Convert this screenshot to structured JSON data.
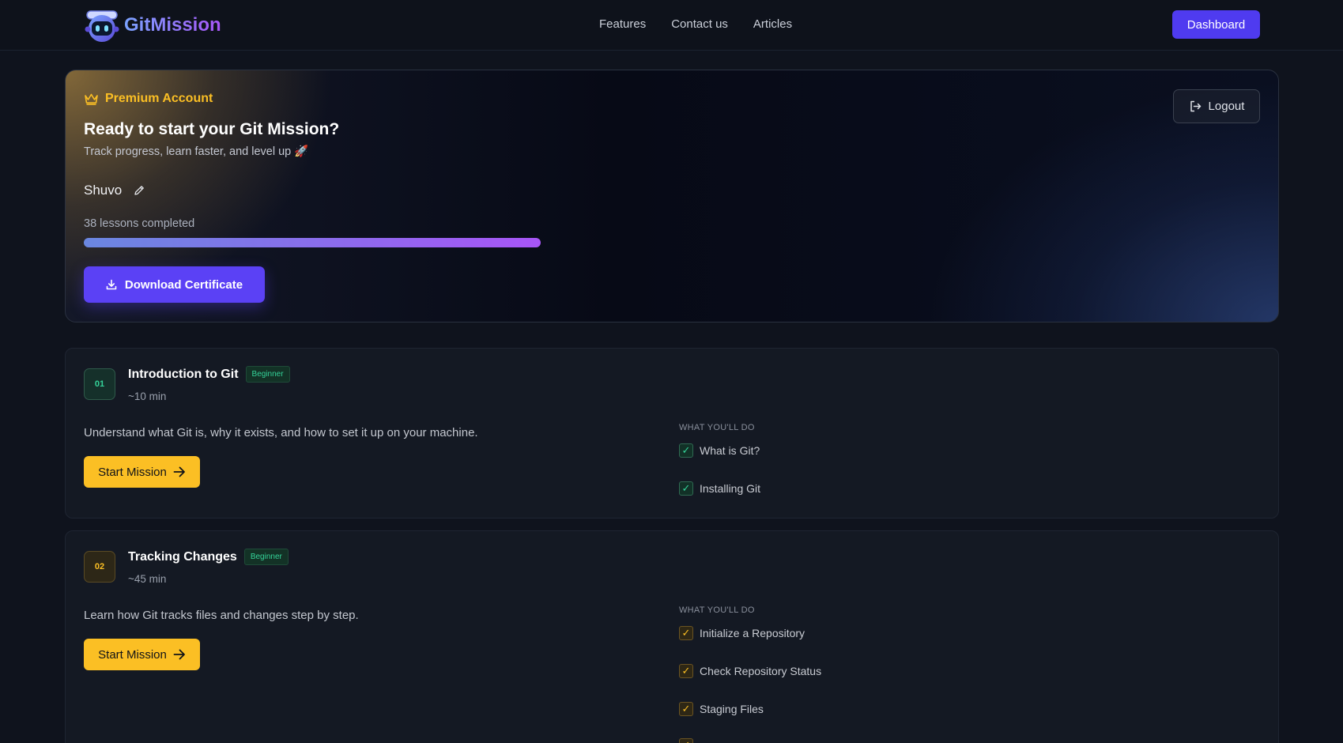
{
  "nav": {
    "logo_text": "GitMission",
    "links": [
      "Features",
      "Contact us",
      "Articles"
    ],
    "dashboard_label": "Dashboard"
  },
  "hero": {
    "premium_label": "Premium Account",
    "title": "Ready to start your Git Mission?",
    "subtitle": "Track progress, learn faster, and level up 🚀",
    "user_name": "Shuvo",
    "lessons_text": "38 lessons completed",
    "progress_fraction": 1.0,
    "certificate_label": "Download Certificate",
    "logout_label": "Logout"
  },
  "missions": [
    {
      "number": "01",
      "title": "Introduction to Git",
      "level": "Beginner",
      "duration": "~10 min",
      "description": "Understand what Git is, why it exists, and how to set it up on your machine.",
      "start_label": "Start Mission",
      "what_label": "WHAT YOU'LL DO",
      "tasks": [
        "What is Git?",
        "Installing Git"
      ]
    },
    {
      "number": "02",
      "title": "Tracking Changes",
      "level": "Beginner",
      "duration": "~45 min",
      "description": "Learn how Git tracks files and changes step by step.",
      "start_label": "Start Mission",
      "what_label": "WHAT YOU'LL DO",
      "tasks": [
        "Initialize a Repository",
        "Check Repository Status",
        "Staging Files"
      ]
    }
  ],
  "colors": {
    "accent_purple": "#5b41f5",
    "accent_yellow": "#fbbf24",
    "accent_green": "#34d399"
  }
}
